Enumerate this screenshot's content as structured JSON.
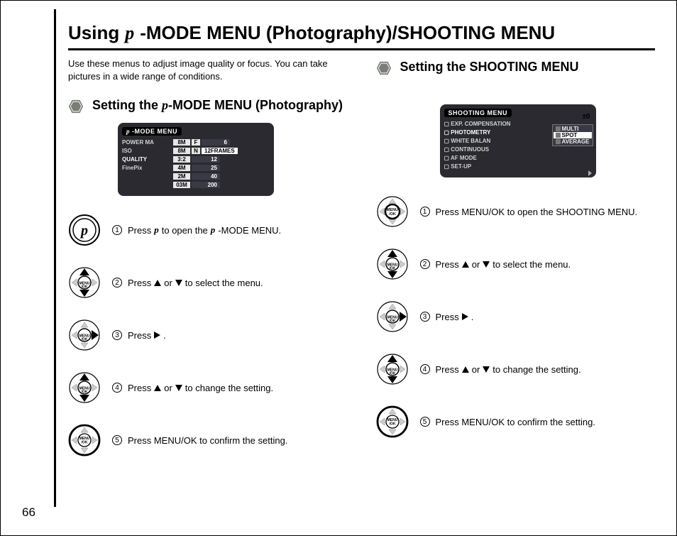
{
  "page_number": "66",
  "title_prefix": "Using ",
  "title_f": "p",
  "title_suffix": "-MODE MENU (Photography)/SHOOTING MENU",
  "intro": "Use these menus to adjust image quality or focus. You can take pictures in a wide range of conditions.",
  "left": {
    "heading_prefix": "Setting the ",
    "heading_f": "p",
    "heading_suffix": "-MODE MENU (Photography)",
    "lcd": {
      "title": "p-MODE MENU",
      "rows": [
        {
          "label": "POWER MA",
          "badge": "8M",
          "mid": "F",
          "val": "6"
        },
        {
          "label": "ISO",
          "badge": "8M",
          "mid": "N",
          "val": "12FRAMES",
          "val_hl": true
        },
        {
          "label": "QUALITY",
          "label_hl": true,
          "badge": "3:2",
          "val": "12"
        },
        {
          "label": "FinePix",
          "badge": "4M",
          "val": "25"
        },
        {
          "label": "",
          "badge": "2M",
          "val": "40"
        },
        {
          "label": "",
          "badge": "03M",
          "val": "200"
        }
      ]
    },
    "steps": [
      {
        "num": "1",
        "t1": "Press ",
        "t2": " to open the ",
        "t3": "-MODE MENU.",
        "has_f": true
      },
      {
        "num": "2",
        "t1": "Press ",
        "t2": " or ",
        "t3": " to select the menu.",
        "arrows": "ud"
      },
      {
        "num": "3",
        "t1": "Press ",
        "t2": ".",
        "arrows": "r"
      },
      {
        "num": "4",
        "t1": "Press ",
        "t2": " or ",
        "t3": " to change the setting.",
        "arrows": "ud"
      },
      {
        "num": "5",
        "t1": "Press MENU/OK to confirm the setting."
      }
    ]
  },
  "right": {
    "heading": "Setting the SHOOTING MENU",
    "lcd": {
      "title": "SHOOTING MENU",
      "side_val": "±0",
      "rows": [
        {
          "label": "EXP. COMPENSATION"
        },
        {
          "label": "PHOTOMETRY",
          "label_hl": true
        },
        {
          "label": "WHITE BALAN"
        },
        {
          "label": "CONTINUOUS"
        },
        {
          "label": "AF MODE"
        },
        {
          "label": "SET-UP"
        }
      ],
      "popup": [
        "MULTI",
        "SPOT",
        "AVERAGE"
      ],
      "popup_sel": 1
    },
    "steps": [
      {
        "num": "1",
        "t1": "Press MENU/OK to open the SHOOTING MENU."
      },
      {
        "num": "2",
        "t1": "Press ",
        "t2": " or ",
        "t3": " to select the menu.",
        "arrows": "ud"
      },
      {
        "num": "3",
        "t1": "Press ",
        "t2": ".",
        "arrows": "r"
      },
      {
        "num": "4",
        "t1": "Press ",
        "t2": " or ",
        "t3": " to change the setting.",
        "arrows": "ud"
      },
      {
        "num": "5",
        "t1": "Press MENU/OK to confirm the setting."
      }
    ]
  }
}
